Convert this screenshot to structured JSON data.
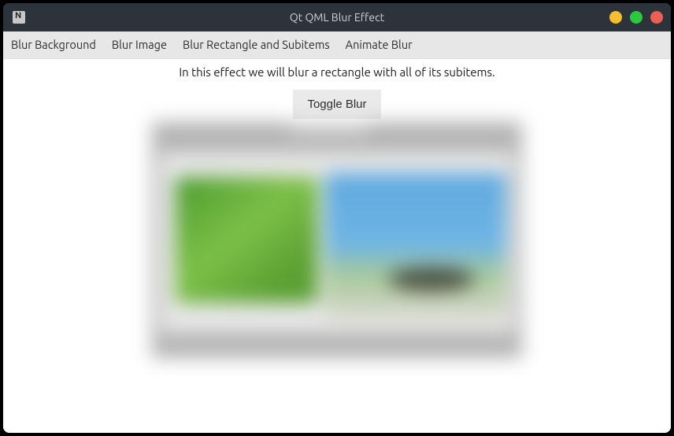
{
  "window": {
    "title": "Qt QML Blur Effect"
  },
  "tabs": [
    {
      "label": "Blur Background"
    },
    {
      "label": "Blur Image"
    },
    {
      "label": "Blur Rectangle and Subitems"
    },
    {
      "label": "Animate Blur"
    }
  ],
  "content": {
    "description": "In this effect we will blur a rectangle with all of its subitems.",
    "toggle_label": "Toggle Blur"
  }
}
